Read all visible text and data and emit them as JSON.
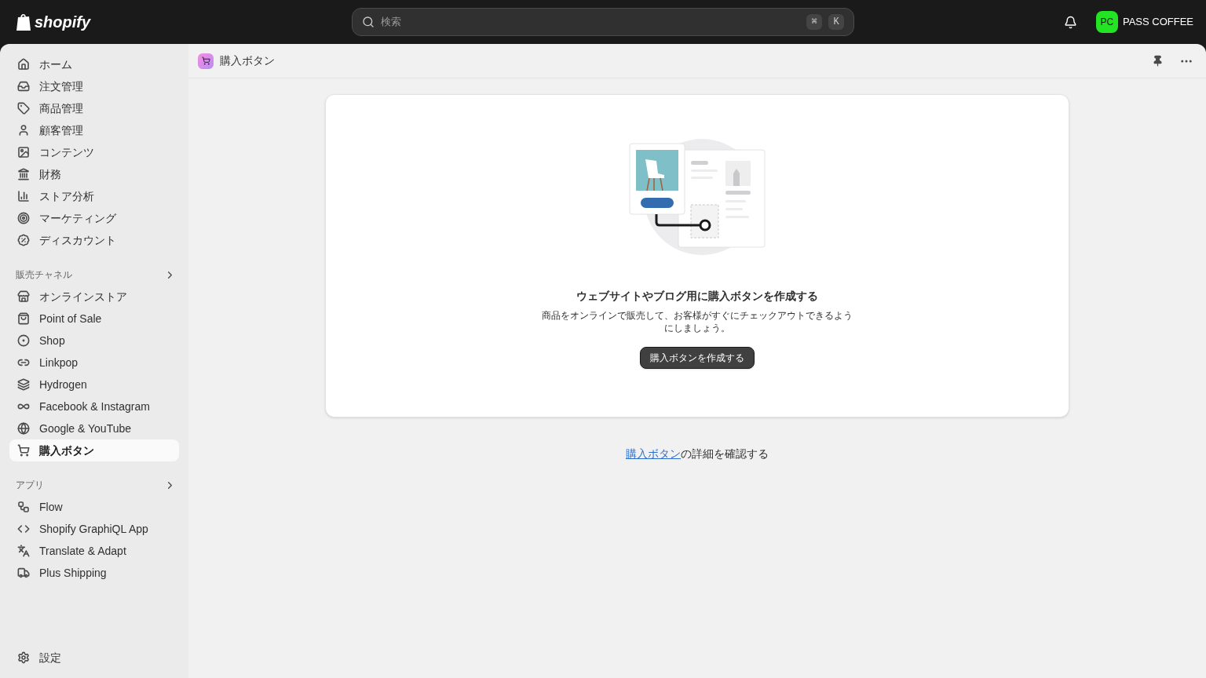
{
  "topbar": {
    "logo": "shopify",
    "search": {
      "placeholder": "検索",
      "shortcut": [
        "⌘",
        "K"
      ]
    },
    "store": {
      "initials": "PC",
      "name": "PASS COFFEE"
    }
  },
  "sidebar": {
    "items": [
      {
        "label": "ホーム",
        "selected": false
      },
      {
        "label": "注文管理",
        "selected": false
      },
      {
        "label": "商品管理",
        "selected": false
      },
      {
        "label": "顧客管理",
        "selected": false
      },
      {
        "label": "コンテンツ",
        "selected": false
      },
      {
        "label": "財務",
        "selected": false
      },
      {
        "label": "ストア分析",
        "selected": false
      },
      {
        "label": "マーケティング",
        "selected": false
      },
      {
        "label": "ディスカウント",
        "selected": false
      }
    ],
    "sections": [
      {
        "title": "販売チャネル",
        "items": [
          {
            "label": "オンラインストア",
            "selected": false
          },
          {
            "label": "Point of Sale",
            "selected": false
          },
          {
            "label": "Shop",
            "selected": false
          },
          {
            "label": "Linkpop",
            "selected": false
          },
          {
            "label": "Hydrogen",
            "selected": false
          },
          {
            "label": "Facebook & Instagram",
            "selected": false
          },
          {
            "label": "Google & YouTube",
            "selected": false
          },
          {
            "label": "購入ボタン",
            "selected": true
          }
        ]
      },
      {
        "title": "アプリ",
        "items": [
          {
            "label": "Flow",
            "selected": false
          },
          {
            "label": "Shopify GraphiQL App",
            "selected": false
          },
          {
            "label": "Translate & Adapt",
            "selected": false
          },
          {
            "label": "Plus Shipping",
            "selected": false
          }
        ]
      }
    ],
    "settings": {
      "label": "設定",
      "selected": false
    }
  },
  "page": {
    "title": "購入ボタン",
    "card": {
      "heading": "ウェブサイトやブログ用に購入ボタンを作成する",
      "body": "商品をオンラインで販売して、お客様がすぐにチェックアウトできるようにしましょう。",
      "button": "購入ボタンを作成する"
    },
    "footer": {
      "link": "購入ボタン",
      "text": "の詳細を確認する"
    }
  }
}
